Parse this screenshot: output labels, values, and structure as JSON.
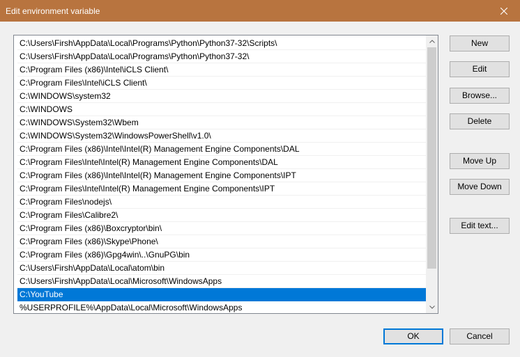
{
  "window": {
    "title": "Edit environment variable"
  },
  "paths": [
    "C:\\Users\\Firsh\\AppData\\Local\\Programs\\Python\\Python37-32\\Scripts\\",
    "C:\\Users\\Firsh\\AppData\\Local\\Programs\\Python\\Python37-32\\",
    "C:\\Program Files (x86)\\Intel\\iCLS Client\\",
    "C:\\Program Files\\Intel\\iCLS Client\\",
    "C:\\WINDOWS\\system32",
    "C:\\WINDOWS",
    "C:\\WINDOWS\\System32\\Wbem",
    "C:\\WINDOWS\\System32\\WindowsPowerShell\\v1.0\\",
    "C:\\Program Files (x86)\\Intel\\Intel(R) Management Engine Components\\DAL",
    "C:\\Program Files\\Intel\\Intel(R) Management Engine Components\\DAL",
    "C:\\Program Files (x86)\\Intel\\Intel(R) Management Engine Components\\IPT",
    "C:\\Program Files\\Intel\\Intel(R) Management Engine Components\\IPT",
    "C:\\Program Files\\nodejs\\",
    "C:\\Program Files\\Calibre2\\",
    "C:\\Program Files (x86)\\Boxcryptor\\bin\\",
    "C:\\Program Files (x86)\\Skype\\Phone\\",
    "C:\\Program Files (x86)\\Gpg4win\\..\\GnuPG\\bin",
    "C:\\Users\\Firsh\\AppData\\Local\\atom\\bin",
    "C:\\Users\\Firsh\\AppData\\Local\\Microsoft\\WindowsApps",
    "C:\\YouTube",
    "%USERPROFILE%\\AppData\\Local\\Microsoft\\WindowsApps"
  ],
  "selected_index": 19,
  "buttons": {
    "new": "New",
    "edit": "Edit",
    "browse": "Browse...",
    "delete": "Delete",
    "move_up": "Move Up",
    "move_down": "Move Down",
    "edit_text": "Edit text...",
    "ok": "OK",
    "cancel": "Cancel"
  },
  "colors": {
    "titlebar": "#b8743f",
    "selection": "#0078d7"
  },
  "icons": {
    "close": "close-icon",
    "scroll_up": "chevron-up-icon",
    "scroll_down": "chevron-down-icon"
  }
}
